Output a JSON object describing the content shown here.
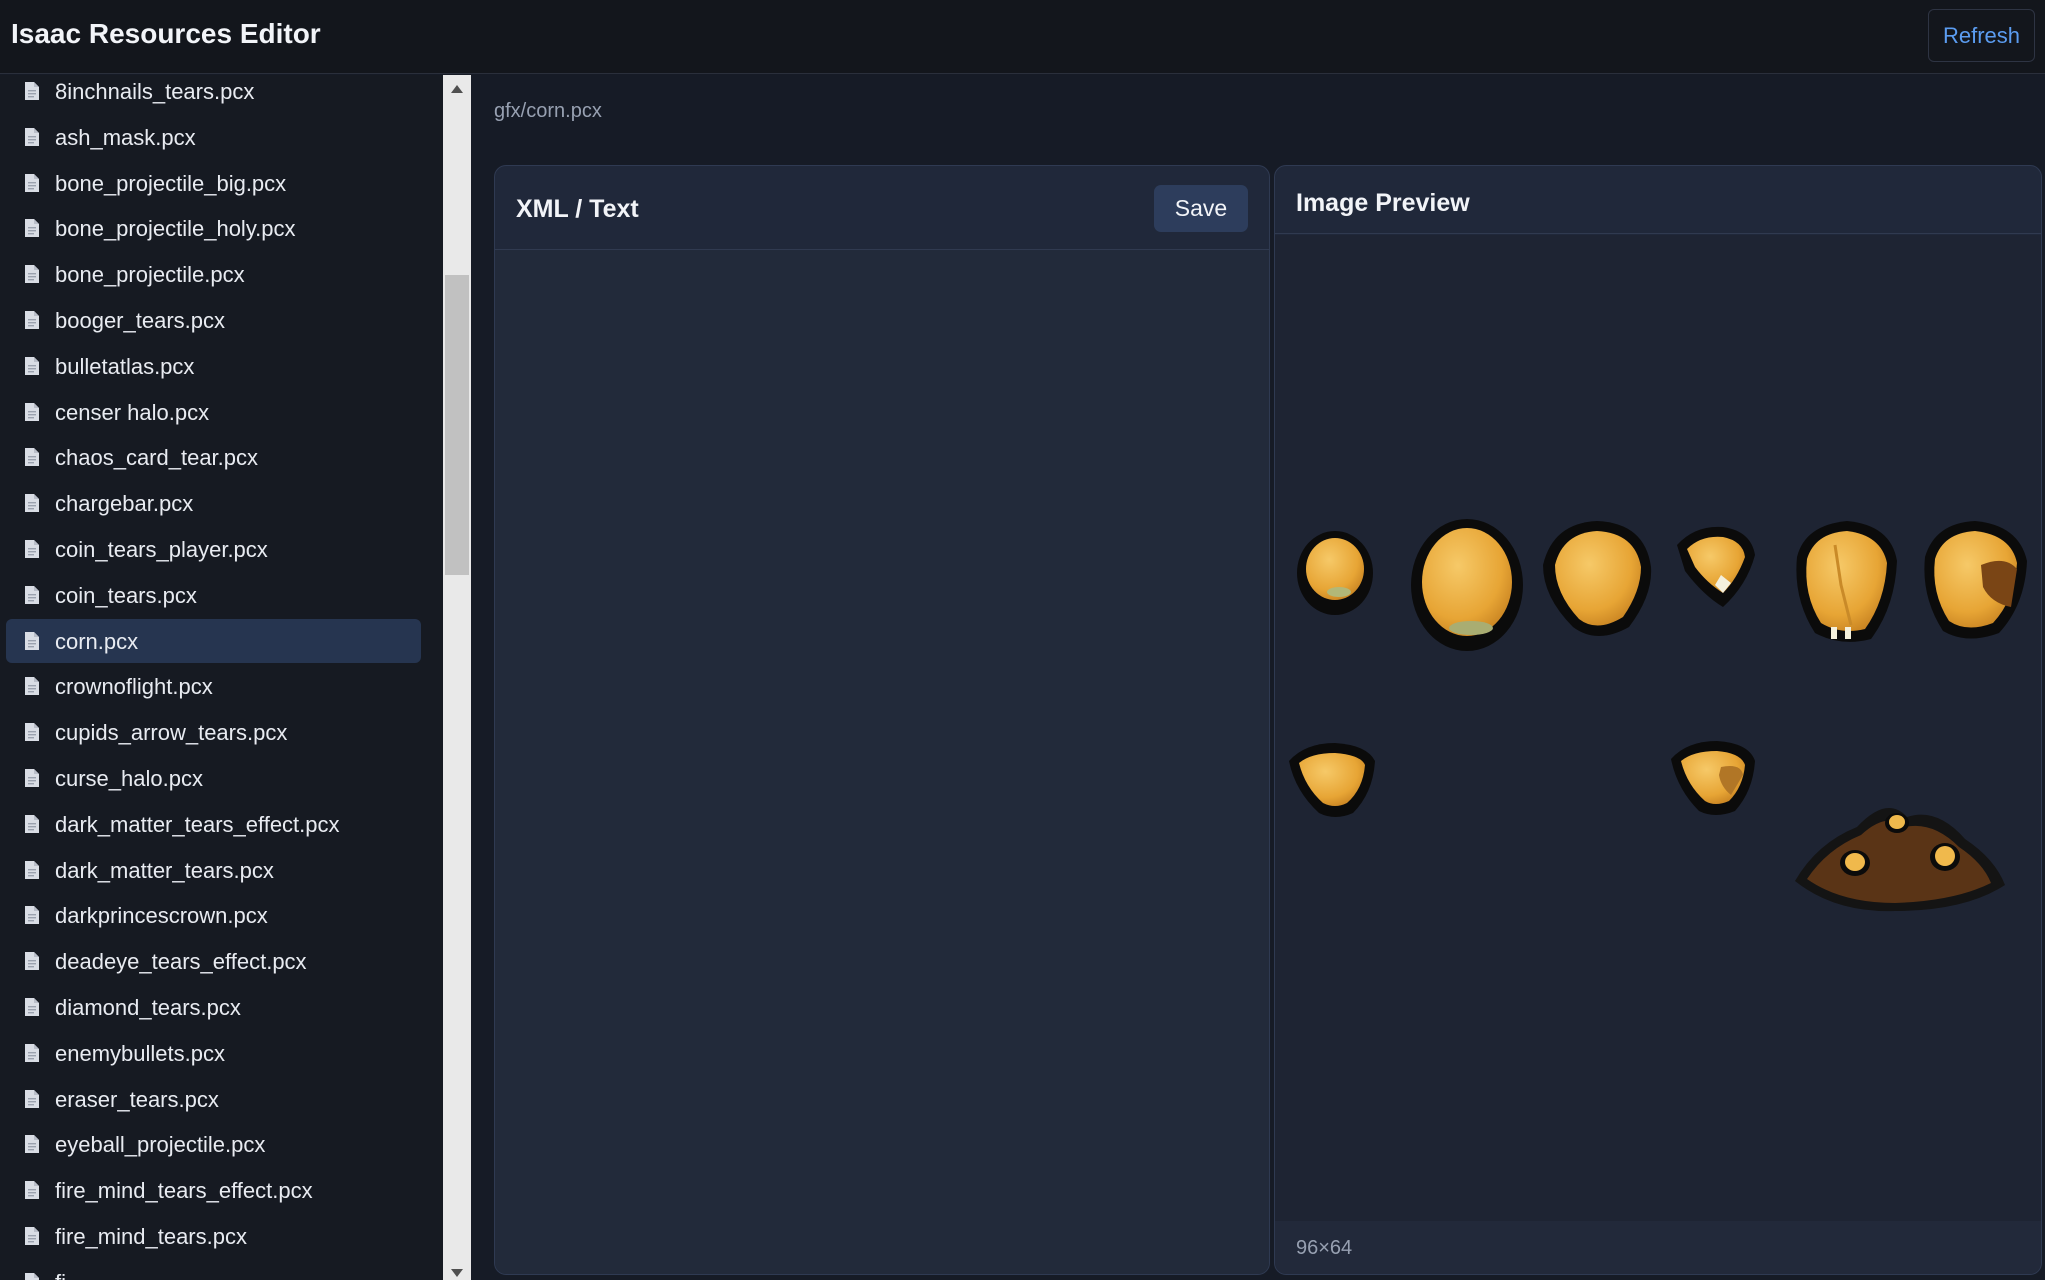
{
  "app": {
    "title": "Isaac Resources Editor",
    "refresh_label": "Refresh"
  },
  "files": [
    "8inchnails_tears.pcx",
    "ash_mask.pcx",
    "bone_projectile_big.pcx",
    "bone_projectile_holy.pcx",
    "bone_projectile.pcx",
    "booger_tears.pcx",
    "bulletatlas.pcx",
    "censer halo.pcx",
    "chaos_card_tear.pcx",
    "chargebar.pcx",
    "coin_tears_player.pcx",
    "coin_tears.pcx",
    "corn.pcx",
    "crownoflight.pcx",
    "cupids_arrow_tears.pcx",
    "curse_halo.pcx",
    "dark_matter_tears_effect.pcx",
    "dark_matter_tears.pcx",
    "darkprincescrown.pcx",
    "deadeye_tears_effect.pcx",
    "diamond_tears.pcx",
    "enemybullets.pcx",
    "eraser_tears.pcx",
    "eyeball_projectile.pcx",
    "fire_mind_tears_effect.pcx",
    "fire_mind_tears.pcx",
    "fi"
  ],
  "selected_file": "corn.pcx",
  "breadcrumb": "gfx/corn.pcx",
  "xml_panel": {
    "title": "XML / Text",
    "save_label": "Save",
    "content": ""
  },
  "preview_panel": {
    "title": "Image Preview",
    "dimensions": "96×64"
  },
  "colors": {
    "accent": "#5b9cf0",
    "selected_bg": "#263550",
    "panel_bg": "#20283a",
    "sprite_gold": "#e9a93c",
    "sprite_outline": "#0b0b0b",
    "sprite_dirt": "#5a3416"
  },
  "icons": {
    "file": "document-icon",
    "scroll_up": "triangle-up-icon",
    "scroll_down": "triangle-down-icon"
  }
}
